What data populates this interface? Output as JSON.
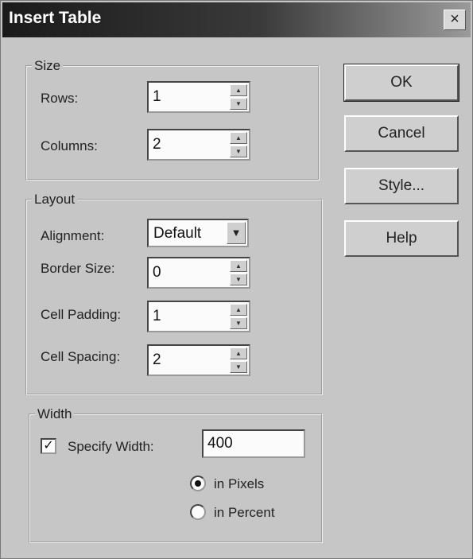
{
  "dialog": {
    "title": "Insert Table",
    "close_label": "×"
  },
  "size": {
    "legend": "Size",
    "rows_label": "Rows:",
    "rows_value": "1",
    "columns_label": "Columns:",
    "columns_value": "2"
  },
  "layout": {
    "legend": "Layout",
    "alignment_label": "Alignment:",
    "alignment_value": "Default",
    "border_label": "Border Size:",
    "border_value": "0",
    "padding_label": "Cell Padding:",
    "padding_value": "1",
    "spacing_label": "Cell Spacing:",
    "spacing_value": "2"
  },
  "width": {
    "legend": "Width",
    "specify_label": "Specify Width:",
    "specify_checked": true,
    "width_value": "400",
    "pixels_label": "in Pixels",
    "percent_label": "in Percent",
    "selected_unit": "pixels"
  },
  "buttons": {
    "ok": "OK",
    "cancel": "Cancel",
    "style": "Style...",
    "help": "Help"
  },
  "icons": {
    "spin_up": "spin-up-arrow",
    "spin_down": "spin-down-arrow",
    "dropdown": "dropdown-arrow",
    "check": "checkmark",
    "close": "close-x"
  }
}
